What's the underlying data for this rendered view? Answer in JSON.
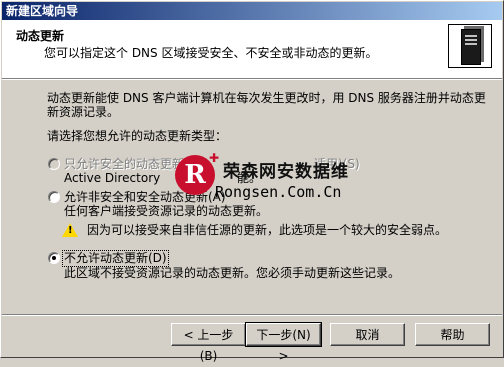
{
  "window": {
    "title": "新建区域向导"
  },
  "header": {
    "title": "动态更新",
    "subtitle": "您可以指定这个 DNS 区域接受安全、不安全或非动态的更新。",
    "icon": "server-icon"
  },
  "intro": {
    "line1": "动态更新能使 DNS 客户端计算机在每次发生更改时，用 DNS 服务器注册并动态更",
    "line2": "新资源记录。"
  },
  "prompt": "请选择您想允许的动态更新类型：",
  "options": [
    {
      "label": "只允许安全的动态更新",
      "label_tail": "适用)(S)",
      "desc": "Active Directory",
      "desc_tail": "能。",
      "selected": false,
      "disabled": true
    },
    {
      "label": "允许非安全和安全动态更新(A)",
      "desc": "任何客户端接受资源记录的动态更新。",
      "warning": "因为可以接受来自非信任源的更新，此选项是一个较大的安全弱点。",
      "selected": false,
      "disabled": false
    },
    {
      "label": "不允许动态更新(D)",
      "desc": "此区域不接受资源记录的动态更新。您必须手动更新这些记录。",
      "selected": true,
      "disabled": false
    }
  ],
  "buttons": {
    "back": "< 上一步(B)",
    "next": "下一步(N) >",
    "cancel": "取消",
    "help": "帮助"
  },
  "watermark": {
    "logo_letter": "R",
    "cn": "荣森网安数据维",
    "en": "Rongsen.Com.Cn"
  }
}
